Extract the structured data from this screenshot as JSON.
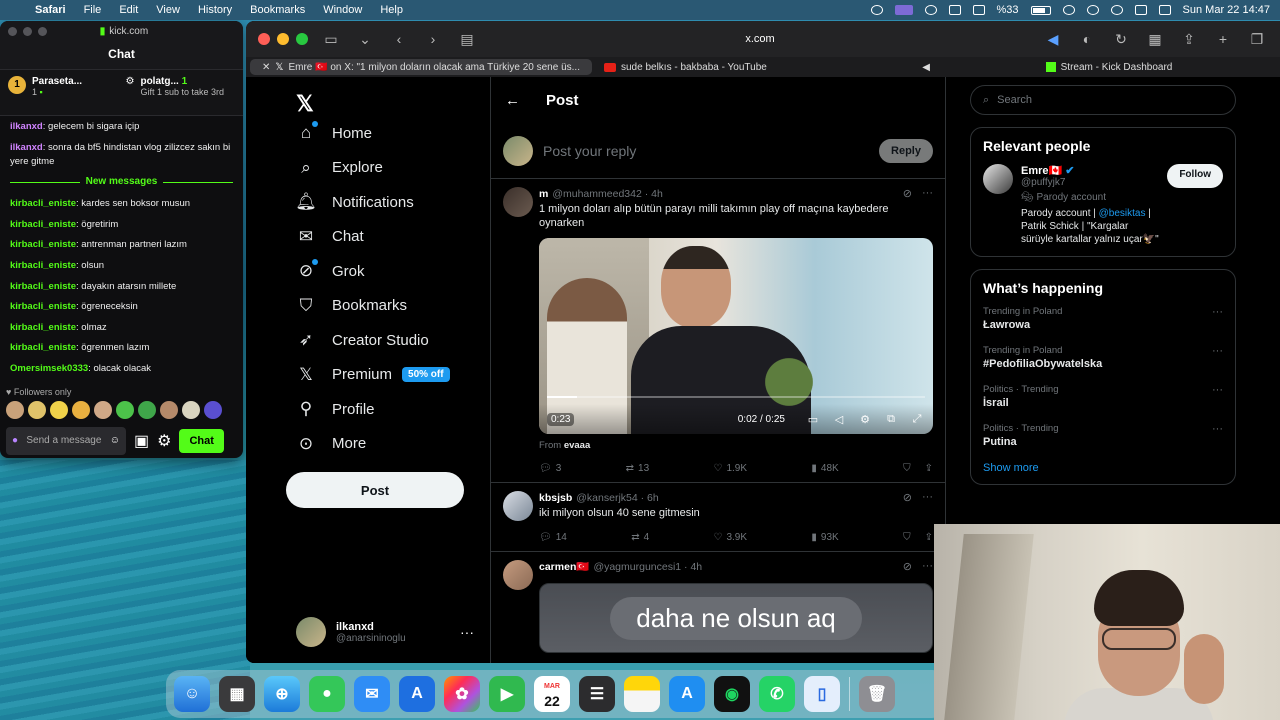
{
  "menubar": {
    "app": "Safari",
    "items": [
      "File",
      "Edit",
      "View",
      "History",
      "Bookmarks",
      "Window",
      "Help"
    ],
    "battery": "%33",
    "datetime": "Sun Mar 22  14:47"
  },
  "kick": {
    "url": "kick.com",
    "title": "Chat",
    "pinned": [
      {
        "name": "Paraseta...",
        "badge": "1",
        "count": "1"
      },
      {
        "name": "polatg...",
        "count": "1",
        "sub": "Gift 1 sub to take 3rd"
      }
    ],
    "messages_top": [
      {
        "user": "ilkanxd",
        "text": "gelecem bi sigara içip",
        "color": "#d084ff"
      },
      {
        "user": "ilkanxd",
        "text": "sonra da bf5 hindistan vlog zilizcez sakın bi yere gitme",
        "color": "#d084ff"
      }
    ],
    "new_messages_label": "New messages",
    "messages": [
      {
        "user": "kirbacli_eniste",
        "text": "kardes sen boksor musun",
        "color": "#53fc18"
      },
      {
        "user": "kirbacli_eniste",
        "text": "ögretirim",
        "color": "#53fc18"
      },
      {
        "user": "kirbacli_eniste",
        "text": "antrenman partneri lazım",
        "color": "#53fc18"
      },
      {
        "user": "kirbacli_eniste",
        "text": "olsun",
        "color": "#53fc18"
      },
      {
        "user": "kirbacli_eniste",
        "text": "dayakın atarsın millete",
        "color": "#53fc18"
      },
      {
        "user": "kirbacli_eniste",
        "text": "ögreneceksin",
        "color": "#53fc18"
      },
      {
        "user": "kirbacli_eniste",
        "text": "olmaz",
        "color": "#53fc18"
      },
      {
        "user": "kirbacli_eniste",
        "text": "ögrenmen lazım",
        "color": "#53fc18"
      },
      {
        "user": "Omersimsek0333",
        "text": "olacak olacak",
        "color": "#53fc18"
      }
    ],
    "followers_only": "Followers only",
    "send_placeholder": "Send a message",
    "chat_button": "Chat"
  },
  "safari": {
    "address": "x.com",
    "tabs": [
      {
        "label": "Emre 🇹🇷 on X: \"1 milyon doların olacak ama Türkiye 20 sene üs...",
        "icon": "x-icon",
        "active": true
      },
      {
        "label": "sude belkıs - bakbaba - YouTube",
        "icon": "youtube-icon",
        "active": false
      },
      {
        "label": "Stream - Kick Dashboard",
        "icon": "kick-icon",
        "active": false
      }
    ]
  },
  "x": {
    "nav": [
      {
        "label": "Home",
        "icon": "home-icon"
      },
      {
        "label": "Explore",
        "icon": "search-icon"
      },
      {
        "label": "Notifications",
        "icon": "bell-icon"
      },
      {
        "label": "Chat",
        "icon": "mail-icon"
      },
      {
        "label": "Grok",
        "icon": "grok-icon"
      },
      {
        "label": "Bookmarks",
        "icon": "bookmark-icon"
      },
      {
        "label": "Creator Studio",
        "icon": "rocket-icon"
      },
      {
        "label": "Premium",
        "icon": "x-icon",
        "badge": "50% off"
      },
      {
        "label": "Profile",
        "icon": "person-icon"
      },
      {
        "label": "More",
        "icon": "more-circle-icon"
      }
    ],
    "post_button": "Post",
    "account": {
      "name": "ilkanxd",
      "handle": "@anarsininoglu"
    },
    "header_title": "Post",
    "reply_placeholder": "Post your reply",
    "reply_button": "Reply",
    "tweets": [
      {
        "name": "m",
        "handle": "@muhammeed342 · 4h",
        "text": "1 milyon doları alıp bütün parayı milli takımın play off maçına kaybedere oynarken",
        "video": {
          "time_left": "0:23",
          "time": "0:02 / 0:25",
          "progress": 0.08
        },
        "from_label": "From",
        "from": "evaaa",
        "stats": {
          "replies": "3",
          "reposts": "13",
          "likes": "1.9K",
          "views": "48K"
        }
      },
      {
        "name": "kbsjsb",
        "handle": "@kanserjk54 · 6h",
        "text": "iki milyon olsun 40 sene gitmesin",
        "stats": {
          "replies": "14",
          "reposts": "4",
          "likes": "3.9K",
          "views": "93K"
        }
      },
      {
        "name": "carmen🇹🇷",
        "handle": "@yagmurguncesi1 · 4h",
        "media_text": "daha ne olsun aq"
      }
    ],
    "search_placeholder": "Search",
    "relevant_title": "Relevant people",
    "relevant": {
      "name": "Emre🇨🇦",
      "handle": "@puffyjk7",
      "tag": "Parody account",
      "bio_pre": "Parody account | ",
      "bio_link": "@besiktas",
      "bio_post": " | Patrik Schick | \"Kargalar sürüyle kartallar yalnız uçar🦅\"",
      "follow": "Follow"
    },
    "happening_title": "What’s happening",
    "trends": [
      {
        "context": "Trending in Poland",
        "title": "Ławrowa"
      },
      {
        "context": "Trending in Poland",
        "title": "#PedofiliaObywatelska"
      },
      {
        "context": "Politics · Trending",
        "title": "İsrail"
      },
      {
        "context": "Politics · Trending",
        "title": "Putina"
      }
    ],
    "show_more": "Show more"
  },
  "dock": {
    "calendar_day": "22",
    "calendar_month": "MAR",
    "apps": [
      "finder",
      "launchpad",
      "safari",
      "messages",
      "mail",
      "xcode",
      "photos",
      "facetime",
      "calendar",
      "reminders",
      "notes",
      "appstore",
      "spotify",
      "whatsapp",
      "preview",
      "trash"
    ]
  }
}
